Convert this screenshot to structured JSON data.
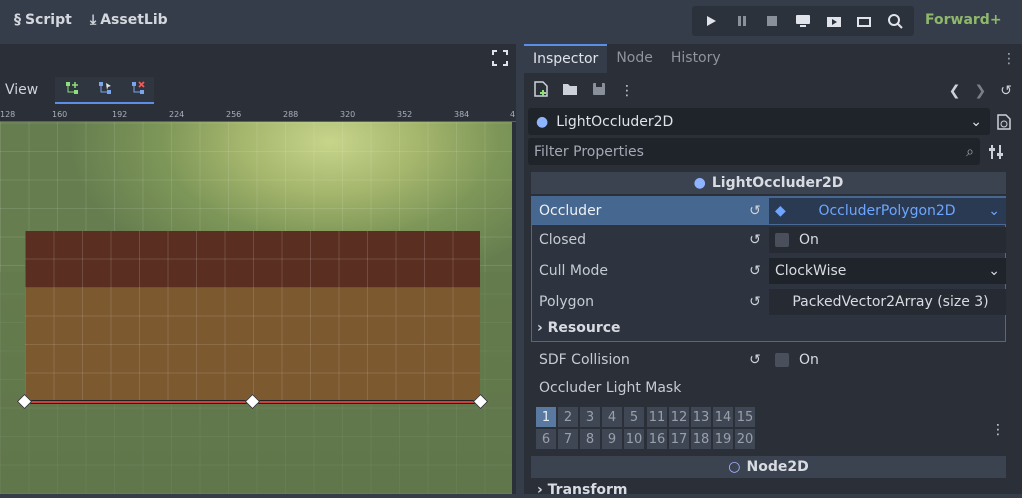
{
  "topbar": {
    "script_label": "Script",
    "assetlib_label": "AssetLib",
    "renderer": "Forward+",
    "play_icons": [
      "play-icon",
      "pause-icon",
      "stop-icon",
      "remote-debug-icon",
      "movie-icon",
      "play-scene-icon",
      "play-custom-icon"
    ]
  },
  "viewport": {
    "view_menu": "View",
    "ruler_ticks": [
      "128",
      "160",
      "192",
      "224",
      "256",
      "288",
      "320",
      "352",
      "384",
      "4"
    ]
  },
  "inspector": {
    "tabs": [
      "Inspector",
      "Node",
      "History"
    ],
    "object_name": "LightOccluder2D",
    "filter_placeholder": "Filter Properties",
    "section_title": "LightOccluder2D",
    "occluder": {
      "label": "Occluder",
      "value": "OccluderPolygon2D"
    },
    "closed": {
      "label": "Closed",
      "value": "On"
    },
    "cull_mode": {
      "label": "Cull Mode",
      "value": "ClockWise"
    },
    "polygon": {
      "label": "Polygon",
      "value": "PackedVector2Array (size 3)"
    },
    "resource_label": "Resource",
    "sdf_collision": {
      "label": "SDF Collision",
      "value": "On"
    },
    "light_mask": {
      "label": "Occluder Light Mask",
      "group1": [
        "1",
        "2",
        "3",
        "4",
        "5",
        "6",
        "7",
        "8",
        "9",
        "10"
      ],
      "group2": [
        "11",
        "12",
        "13",
        "14",
        "15",
        "16",
        "17",
        "18",
        "19",
        "20"
      ]
    },
    "node2d_section": "Node2D",
    "transform_label": "Transform"
  }
}
